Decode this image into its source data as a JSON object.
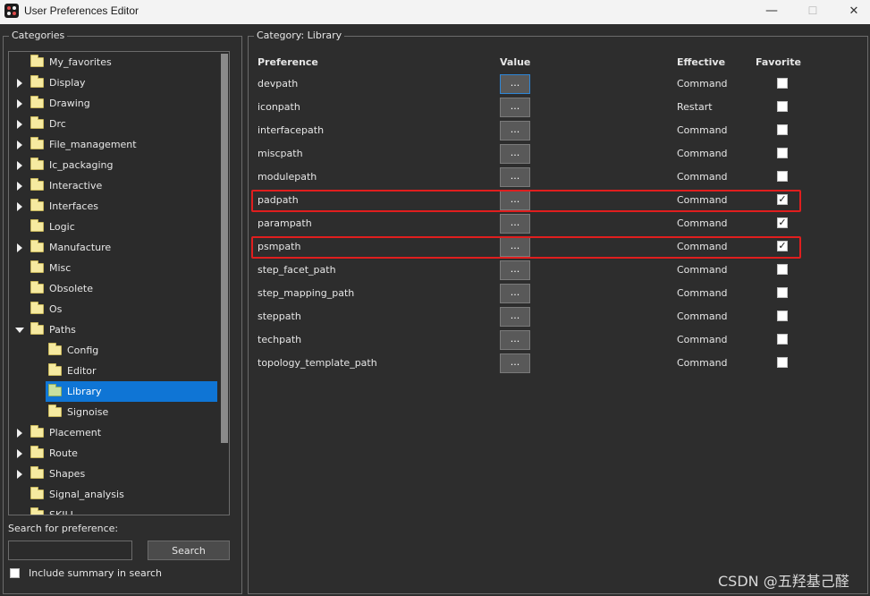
{
  "window": {
    "title": "User Preferences Editor",
    "minimize_glyph": "—",
    "maximize_glyph": "☐",
    "close_glyph": "✕"
  },
  "sidebar": {
    "group_title": "Categories",
    "items": [
      {
        "label": "My_favorites",
        "expander": "none",
        "depth": 0
      },
      {
        "label": "Display",
        "expander": "collapsed",
        "depth": 0
      },
      {
        "label": "Drawing",
        "expander": "collapsed",
        "depth": 0
      },
      {
        "label": "Drc",
        "expander": "collapsed",
        "depth": 0
      },
      {
        "label": "File_management",
        "expander": "collapsed",
        "depth": 0
      },
      {
        "label": "Ic_packaging",
        "expander": "collapsed",
        "depth": 0
      },
      {
        "label": "Interactive",
        "expander": "collapsed",
        "depth": 0
      },
      {
        "label": "Interfaces",
        "expander": "collapsed",
        "depth": 0
      },
      {
        "label": "Logic",
        "expander": "none",
        "depth": 0
      },
      {
        "label": "Manufacture",
        "expander": "collapsed",
        "depth": 0
      },
      {
        "label": "Misc",
        "expander": "none",
        "depth": 0
      },
      {
        "label": "Obsolete",
        "expander": "none",
        "depth": 0
      },
      {
        "label": "Os",
        "expander": "none",
        "depth": 0
      },
      {
        "label": "Paths",
        "expander": "expanded",
        "depth": 0
      },
      {
        "label": "Config",
        "expander": "none",
        "depth": 1
      },
      {
        "label": "Editor",
        "expander": "none",
        "depth": 1
      },
      {
        "label": "Library",
        "expander": "none",
        "depth": 1,
        "selected": true
      },
      {
        "label": "Signoise",
        "expander": "none",
        "depth": 1
      },
      {
        "label": "Placement",
        "expander": "collapsed",
        "depth": 0
      },
      {
        "label": "Route",
        "expander": "collapsed",
        "depth": 0
      },
      {
        "label": "Shapes",
        "expander": "collapsed",
        "depth": 0
      },
      {
        "label": "Signal_analysis",
        "expander": "none",
        "depth": 0
      },
      {
        "label": "SKILL",
        "expander": "none",
        "depth": 0
      }
    ],
    "search_label": "Search for preference:",
    "search_value": "",
    "search_button": "Search",
    "include_summary_label": "Include summary in search",
    "include_summary_checked": false
  },
  "main": {
    "group_title": "Category:  Library",
    "columns": {
      "preference": "Preference",
      "value": "Value",
      "effective": "Effective",
      "favorite": "Favorite"
    },
    "value_button_label": "...",
    "rows": [
      {
        "name": "devpath",
        "effective": "Command",
        "favorite": false,
        "focused": true,
        "highlighted": false
      },
      {
        "name": "iconpath",
        "effective": "Restart",
        "favorite": false,
        "highlighted": false
      },
      {
        "name": "interfacepath",
        "effective": "Command",
        "favorite": false,
        "highlighted": false
      },
      {
        "name": "miscpath",
        "effective": "Command",
        "favorite": false,
        "highlighted": false
      },
      {
        "name": "modulepath",
        "effective": "Command",
        "favorite": false,
        "highlighted": false
      },
      {
        "name": "padpath",
        "effective": "Command",
        "favorite": true,
        "highlighted": true
      },
      {
        "name": "parampath",
        "effective": "Command",
        "favorite": true,
        "highlighted": false
      },
      {
        "name": "psmpath",
        "effective": "Command",
        "favorite": true,
        "highlighted": true
      },
      {
        "name": "step_facet_path",
        "effective": "Command",
        "favorite": false,
        "highlighted": false
      },
      {
        "name": "step_mapping_path",
        "effective": "Command",
        "favorite": false,
        "highlighted": false
      },
      {
        "name": "steppath",
        "effective": "Command",
        "favorite": false,
        "highlighted": false
      },
      {
        "name": "techpath",
        "effective": "Command",
        "favorite": false,
        "highlighted": false
      },
      {
        "name": "topology_template_path",
        "effective": "Command",
        "favorite": false,
        "highlighted": false
      }
    ]
  },
  "watermark": "CSDN @五羟基己醛",
  "colors": {
    "selection": "#0f75d5",
    "highlight_box": "#e01e1e",
    "background": "#2d2d2d"
  }
}
